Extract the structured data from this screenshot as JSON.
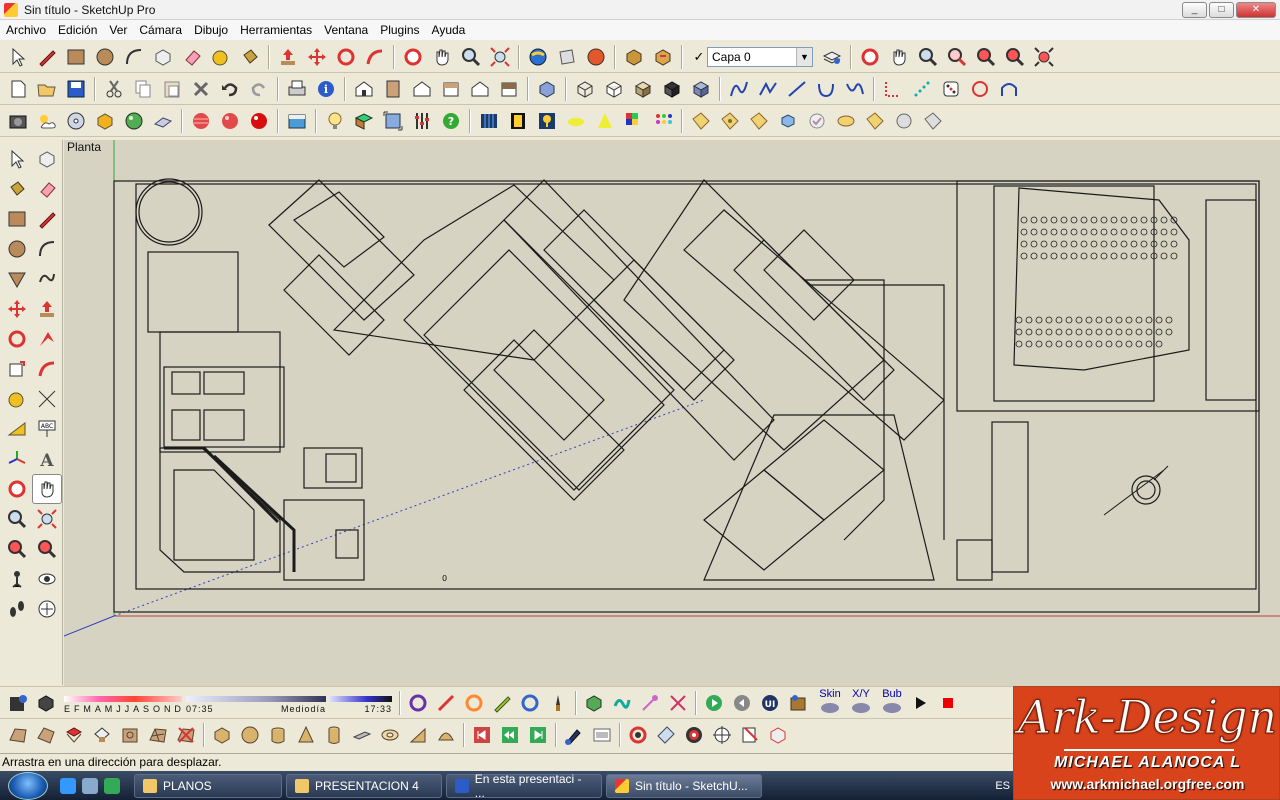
{
  "window": {
    "title": "Sin título - SketchUp Pro",
    "minimize": "_",
    "maximize": "□",
    "close": "✕"
  },
  "menu": [
    "Archivo",
    "Edición",
    "Ver",
    "Cámara",
    "Dibujo",
    "Herramientas",
    "Ventana",
    "Plugins",
    "Ayuda"
  ],
  "layers": {
    "current": "Capa 0",
    "check": "✓"
  },
  "viewport": {
    "scene_label": "Planta",
    "axis_label": "0"
  },
  "shadows": {
    "months": [
      "E",
      "F",
      "M",
      "A",
      "M",
      "J",
      "J",
      "A",
      "S",
      "O",
      "N",
      "D"
    ],
    "time_start": "07:35",
    "time_mid": "Mediodía",
    "time_end": "17:33"
  },
  "skin_tools": [
    "Skin",
    "X/Y",
    "Bub"
  ],
  "statusbar": {
    "text": "Arrastra en una dirección para desplazar."
  },
  "taskbar": {
    "items": [
      {
        "label": "PLANOS",
        "active": false
      },
      {
        "label": "PRESENTACION 4",
        "active": false
      },
      {
        "label": "En esta presentaci - ...",
        "active": false
      },
      {
        "label": "Sin título - SketchU...",
        "active": true
      }
    ],
    "lang": "ES"
  },
  "brand": {
    "logo": "Ark-Design",
    "name": "MICHAEL ALANOCA L",
    "url": "www.arkmichael.orgfree.com"
  },
  "colors": {
    "viewport_bg": "#d6d3c2",
    "chrome_bg": "#ece9d8",
    "brand_bg": "#d8431c",
    "red_axis": "#c04040",
    "blue_axis": "#3040c0"
  }
}
